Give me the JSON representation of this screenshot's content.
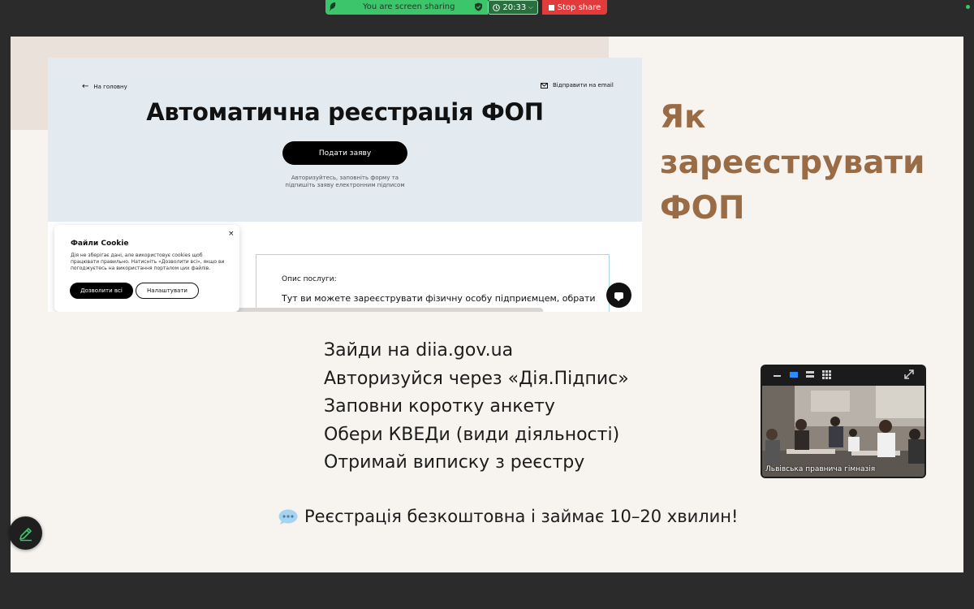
{
  "share_bar": {
    "status": "You are screen sharing",
    "time": "20:33",
    "stop_label": "Stop share"
  },
  "site": {
    "back_label": "На головну",
    "email_label": "Відправити на email",
    "title": "Автоматична реєстрація ФОП",
    "apply_label": "Подати заяву",
    "apply_sub_1": "Авторизуйтесь, заповніть форму та",
    "apply_sub_2": "підпишіть заяву електронним підписом",
    "service_label": "Опис послуги:",
    "service_text": "Тут ви можете зареєструвати фізичну особу підприємцем, обрати"
  },
  "cookie": {
    "title": "Файли Cookie",
    "close": "×",
    "text": "Дія не зберігає дані, але використовує cookies щоб працювати правильно. Натисніть «Дозволити всі», якщо ви погоджуєтесь на використання порталом цих файлів.",
    "allow_label": "Дозволити всі",
    "settings_label": "Налаштувати"
  },
  "heading": {
    "line1": "Як",
    "line2": "зареєструвати",
    "line3": "ФОП"
  },
  "steps": [
    "Зайди на diia.gov.ua",
    "Авторизуйся через «Дія.Підпис»",
    "Заповни коротку анкету",
    "Обери КВЕДи (види діяльності)",
    "Отримай виписку з реєстру"
  ],
  "footer_note": "Реєстрація безкоштовна і займає 10–20 хвилин!",
  "video": {
    "caption": "Львівська правнича гімназія"
  },
  "colors": {
    "accent": "#9a6c45",
    "share_green": "#3cc56a",
    "stop_red": "#e33b3b",
    "slide_bg": "#f7f4ef",
    "hero_bg": "#e3ebf1"
  }
}
